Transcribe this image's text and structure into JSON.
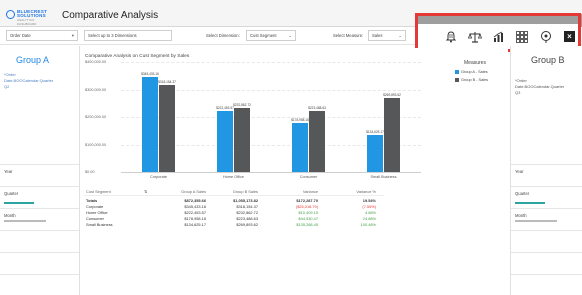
{
  "header": {
    "logo_line1": "BLUECREST",
    "logo_line2": "SOLUTIONS",
    "logo_tag": "ANALYTICS DASHBOARD",
    "title": "Comparative Analysis"
  },
  "filters": {
    "order_date": "Order Date",
    "dimensions_placeholder": "Select up to 3 Dimensions",
    "select_dimension_label": "Select Dimension:",
    "dimension_value": "Cust Segment",
    "select_measure_label": "Select Measure:",
    "measure_value": "Sales"
  },
  "toolbar": {
    "icons": [
      "bell-settings-icon",
      "balance-scale-icon",
      "bar-chart-icon",
      "grid-icon",
      "pin-settings-icon",
      "close-icon"
    ],
    "close_label": "×"
  },
  "group_a": {
    "title": "Group A",
    "selection_line1": "*Order",
    "selection_line2": "Date.BOOCalendar.Quarter",
    "selection_line3": "Q2",
    "year_label": "Year",
    "quarter_label": "Quarter",
    "month_label": "Month"
  },
  "group_b": {
    "title": "Group B",
    "selection_line1": "*Order",
    "selection_line2": "Date.BOOCalendar.Quarter",
    "selection_line3": "Q3",
    "year_label": "Year",
    "quarter_label": "Quarter",
    "month_label": "Month"
  },
  "chart_data": {
    "type": "bar",
    "title": "Comparative Analysis on Cust Segment by Sales",
    "categories": [
      "Corporate",
      "Home Office",
      "Consumer",
      "Small Business"
    ],
    "series": [
      {
        "name": "Group A - Sales",
        "values": [
          345433.16,
          222453.57,
          178958.16,
          134625.17
        ],
        "labels": [
          "$345,433.16",
          "$222,453.57",
          "$178,958.16",
          "$134,625.17"
        ],
        "color": "#2196e3"
      },
      {
        "name": "Group B - Sales",
        "values": [
          318154.37,
          232862.72,
          223488.63,
          269893.62
        ],
        "labels": [
          "$318,154.37",
          "$232,862.72",
          "$223,488.63",
          "$269,893.62"
        ],
        "color": "#555759"
      }
    ],
    "yticks": [
      "$400,000.00",
      "$300,000.00",
      "$200,000.00",
      "$100,000.00",
      "$0.00"
    ],
    "ylim": [
      0,
      400000
    ],
    "legend_title": "Measures",
    "legend_position": "top-right"
  },
  "table": {
    "headers": [
      "Cust Segment",
      "Group A Sales",
      "Group B Sales",
      "Variance",
      "Variance %"
    ],
    "rows": [
      {
        "seg": "Totals",
        "a": "$872,355.66",
        "b": "$1,055,173.82",
        "var": "$172,287.70",
        "pct": "19.54%",
        "bold": true
      },
      {
        "seg": "Corporate",
        "a": "$345,433.16",
        "b": "$318,154.37",
        "var": "($25,018.79)",
        "pct": "(7.55%)",
        "neg": true
      },
      {
        "seg": "Home Office",
        "a": "$222,453.57",
        "b": "$232,862.72",
        "var": "$10,409.15",
        "pct": "4.68%",
        "neg": false
      },
      {
        "seg": "Consumer",
        "a": "$178,958.16",
        "b": "$223,488.63",
        "var": "$44,530.47",
        "pct": "24.88%",
        "neg": false
      },
      {
        "seg": "Small Business",
        "a": "$134,625.17",
        "b": "$269,893.62",
        "var": "$135,268.45",
        "pct": "100.48%",
        "neg": false
      }
    ]
  }
}
